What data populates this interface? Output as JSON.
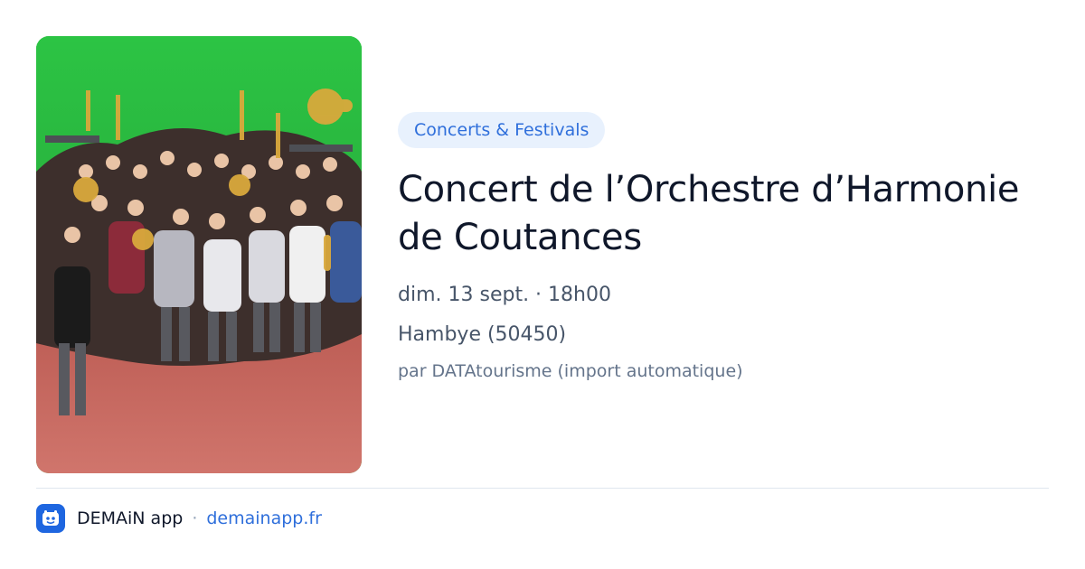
{
  "event": {
    "category": "Concerts & Festivals",
    "title": "Concert de l’Orchestre d’Harmonie de Coutances",
    "date_time": "dim. 13 sept. · 18h00",
    "location": "Hambye (50450)",
    "source": "par DATAtourisme (import automatique)"
  },
  "footer": {
    "app_name": "DEMAiN app",
    "separator": "·",
    "domain": "demainapp.fr"
  },
  "colors": {
    "accent": "#2f6fdb",
    "badge_bg": "#e8f1fd",
    "app_icon_bg": "#1e66e0",
    "photo_wall": "#2fbf3e",
    "photo_floor": "#c9605a"
  },
  "icons": {
    "app_icon": "demain-app-icon"
  }
}
